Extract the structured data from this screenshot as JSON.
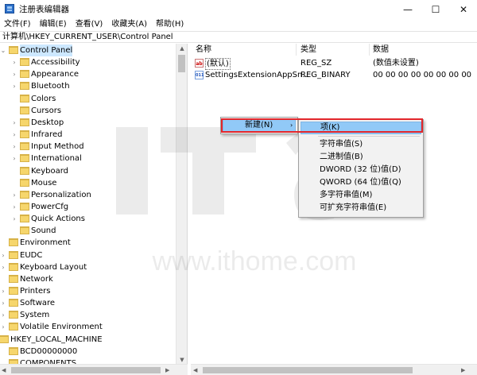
{
  "window": {
    "title": "注册表编辑器",
    "minimize": "—",
    "maximize": "☐",
    "close": "✕"
  },
  "menubar": {
    "items": [
      "文件(F)",
      "编辑(E)",
      "查看(V)",
      "收藏夹(A)",
      "帮助(H)"
    ]
  },
  "address": "计算机\\HKEY_CURRENT_USER\\Control Panel",
  "tree": [
    {
      "label": "Control Panel",
      "level": 0,
      "twisty": "⌄",
      "selected": true
    },
    {
      "label": "Accessibility",
      "level": 1,
      "twisty": "›"
    },
    {
      "label": "Appearance",
      "level": 1,
      "twisty": "›"
    },
    {
      "label": "Bluetooth",
      "level": 1,
      "twisty": "›"
    },
    {
      "label": "Colors",
      "level": 1,
      "twisty": ""
    },
    {
      "label": "Cursors",
      "level": 1,
      "twisty": ""
    },
    {
      "label": "Desktop",
      "level": 1,
      "twisty": "›"
    },
    {
      "label": "Infrared",
      "level": 1,
      "twisty": "›"
    },
    {
      "label": "Input Method",
      "level": 1,
      "twisty": "›"
    },
    {
      "label": "International",
      "level": 1,
      "twisty": "›"
    },
    {
      "label": "Keyboard",
      "level": 1,
      "twisty": ""
    },
    {
      "label": "Mouse",
      "level": 1,
      "twisty": ""
    },
    {
      "label": "Personalization",
      "level": 1,
      "twisty": "›"
    },
    {
      "label": "PowerCfg",
      "level": 1,
      "twisty": "›"
    },
    {
      "label": "Quick Actions",
      "level": 1,
      "twisty": "›"
    },
    {
      "label": "Sound",
      "level": 1,
      "twisty": ""
    },
    {
      "label": "Environment",
      "level": 0,
      "twisty": ""
    },
    {
      "label": "EUDC",
      "level": 0,
      "twisty": "›"
    },
    {
      "label": "Keyboard Layout",
      "level": 0,
      "twisty": "›"
    },
    {
      "label": "Network",
      "level": 0,
      "twisty": ""
    },
    {
      "label": "Printers",
      "level": 0,
      "twisty": "›"
    },
    {
      "label": "Software",
      "level": 0,
      "twisty": "›"
    },
    {
      "label": "System",
      "level": 0,
      "twisty": "›"
    },
    {
      "label": "Volatile Environment",
      "level": 0,
      "twisty": "›"
    },
    {
      "label": "HKEY_LOCAL_MACHINE",
      "level": -1,
      "twisty": "⌄"
    },
    {
      "label": "BCD00000000",
      "level": 0,
      "twisty": ""
    },
    {
      "label": "COMPONENTS",
      "level": 0,
      "twisty": ""
    }
  ],
  "list": {
    "headers": {
      "name": "名称",
      "type": "类型",
      "data": "数据"
    },
    "rows": [
      {
        "icon": "ab",
        "name": "(默认)",
        "type": "REG_SZ",
        "data": "(数值未设置)"
      },
      {
        "icon": "011",
        "name": "SettingsExtensionAppSn...",
        "type": "REG_BINARY",
        "data": "00 00 00 00 00 00 00 00"
      }
    ]
  },
  "context_menu": {
    "new_label": "新建(N)",
    "arrow": "›"
  },
  "submenu": [
    "项(K)",
    "字符串值(S)",
    "二进制值(B)",
    "DWORD (32 位)值(D)",
    "QWORD (64 位)值(Q)",
    "多字符串值(M)",
    "可扩充字符串值(E)"
  ],
  "watermark": "www.ithome.com",
  "colors": {
    "highlight": "#91c9f7",
    "redbox": "#e3262b",
    "folder": "#f6d66c"
  }
}
